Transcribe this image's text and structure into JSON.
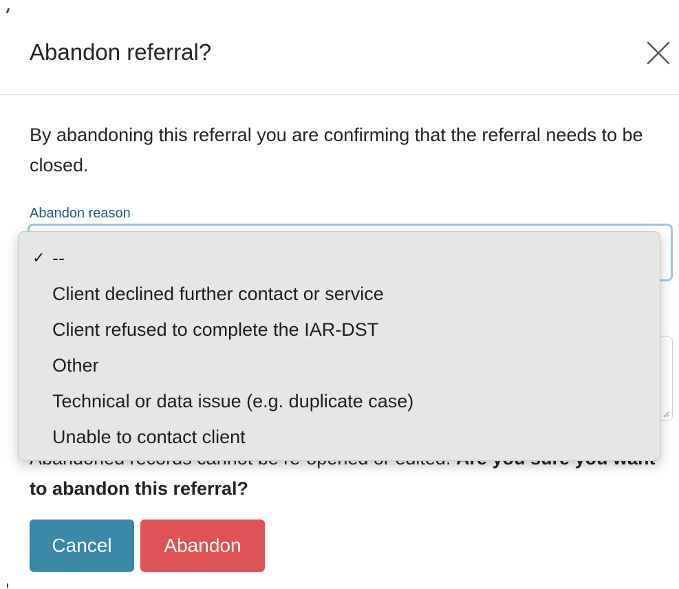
{
  "modal": {
    "title": "Abandon referral?",
    "close_icon": "close-icon",
    "intro": "By abandoning this referral you are confirming that the referral needs to be closed.",
    "reason_label": "Abandon reason",
    "warning_prefix": "Abandoned records cannot be re-opened or edited. ",
    "warning_bold": "Are you sure you want to abandon this referral?",
    "cancel_label": "Cancel",
    "abandon_label": "Abandon"
  },
  "dropdown": {
    "check_glyph": "✓",
    "selected": "--",
    "options": [
      "--",
      "Client declined further contact or service",
      "Client refused to complete the IAR-DST",
      "Other",
      "Technical or data issue (e.g. duplicate case)",
      "Unable to contact client"
    ]
  },
  "colors": {
    "primary": "#3a87a6",
    "danger": "#e05256",
    "label": "#1f5a75",
    "focus_border": "#9ec5d8"
  }
}
